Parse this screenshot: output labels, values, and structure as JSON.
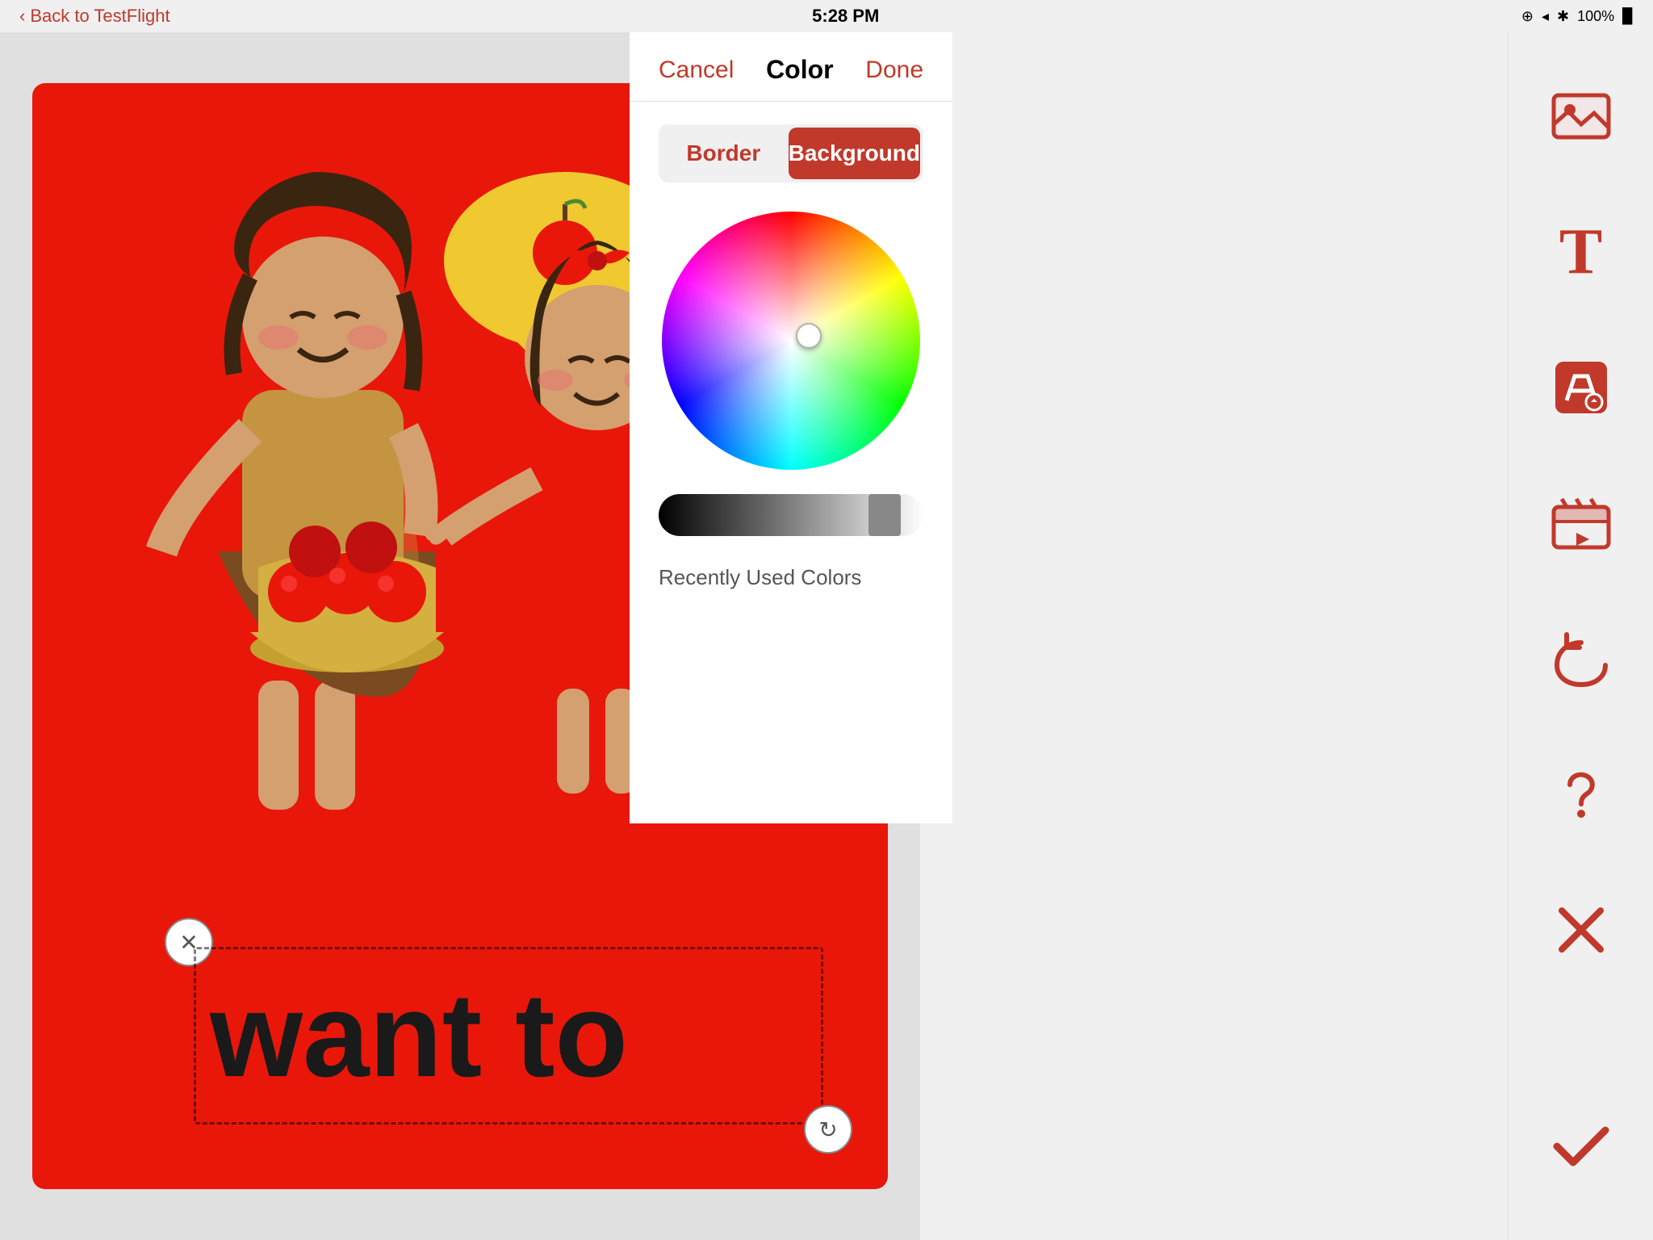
{
  "statusBar": {
    "backLabel": "Back to TestFlight",
    "time": "5:28 PM",
    "batteryPercent": "100%"
  },
  "colorPanel": {
    "title": "Color",
    "cancelLabel": "Cancel",
    "doneLabel": "Done",
    "borderLabel": "Border",
    "backgroundLabel": "Background",
    "recentlyUsedLabel": "Recently Used Colors",
    "activeTab": "background"
  },
  "textBox": {
    "text": "want to"
  },
  "toolbar": {
    "items": [
      {
        "name": "image-icon",
        "label": "📷"
      },
      {
        "name": "text-icon",
        "label": "T"
      },
      {
        "name": "draw-icon",
        "label": "✏"
      },
      {
        "name": "video-icon",
        "label": "▶"
      },
      {
        "name": "undo-icon",
        "label": "↺"
      },
      {
        "name": "help-icon",
        "label": "?"
      },
      {
        "name": "close-icon",
        "label": "✕"
      },
      {
        "name": "check-icon",
        "label": "✓"
      }
    ]
  }
}
